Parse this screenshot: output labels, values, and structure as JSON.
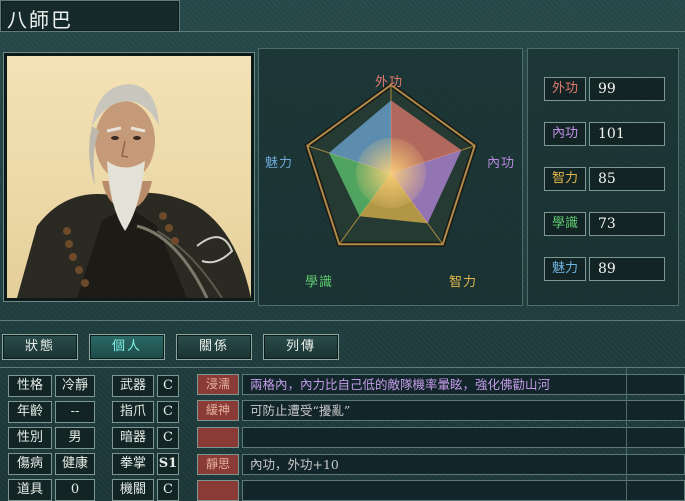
{
  "character": {
    "name": "八師巴"
  },
  "radar": {
    "labels": {
      "top": "外功",
      "right": "內功",
      "bottom_right": "智力",
      "bottom_left": "學識",
      "left": "魅力"
    },
    "colors": {
      "top": "#e07a6e",
      "right": "#b98adf",
      "bottom_right": "#e0b64e",
      "bottom_left": "#5fc86f",
      "left": "#6fa9d8"
    },
    "values": [
      99,
      101,
      85,
      73,
      89
    ],
    "max": 120
  },
  "stats": [
    {
      "label": "外功",
      "value": "99",
      "color": "#e07a6e"
    },
    {
      "label": "內功",
      "value": "101",
      "color": "#c592ea"
    },
    {
      "label": "智力",
      "value": "85",
      "color": "#e0b64e"
    },
    {
      "label": "學識",
      "value": "73",
      "color": "#5fc86f"
    },
    {
      "label": "魅力",
      "value": "89",
      "color": "#6fb3e0"
    }
  ],
  "tabs": [
    "狀態",
    "個人",
    "關係",
    "列傳"
  ],
  "active_tab": 1,
  "personal": [
    {
      "key": "性格",
      "value": "冷靜"
    },
    {
      "key": "年齡",
      "value": "--"
    },
    {
      "key": "性別",
      "value": "男"
    },
    {
      "key": "傷病",
      "value": "健康"
    },
    {
      "key": "道具",
      "value": "0"
    }
  ],
  "weapons": [
    {
      "key": "武器",
      "grade": "C"
    },
    {
      "key": "指爪",
      "grade": "C"
    },
    {
      "key": "暗器",
      "grade": "C"
    },
    {
      "key": "拳掌",
      "grade": "S1"
    },
    {
      "key": "機關",
      "grade": "C"
    }
  ],
  "skills": [
    {
      "name": "浸濡",
      "desc": "兩格內，內力比自己低的敵隊機率暈眩，強化佛勸山河",
      "color": "#c39be8"
    },
    {
      "name": "緩神",
      "desc": "可防止遭受“擾亂”",
      "color": "#c9c9c9"
    },
    {
      "name": "",
      "desc": "",
      "color": "#c9c9c9"
    },
    {
      "name": "靜思",
      "desc": "內功，外功+10",
      "color": "#c9c9c9"
    },
    {
      "name": "",
      "desc": "",
      "color": "#c9c9c9"
    }
  ]
}
